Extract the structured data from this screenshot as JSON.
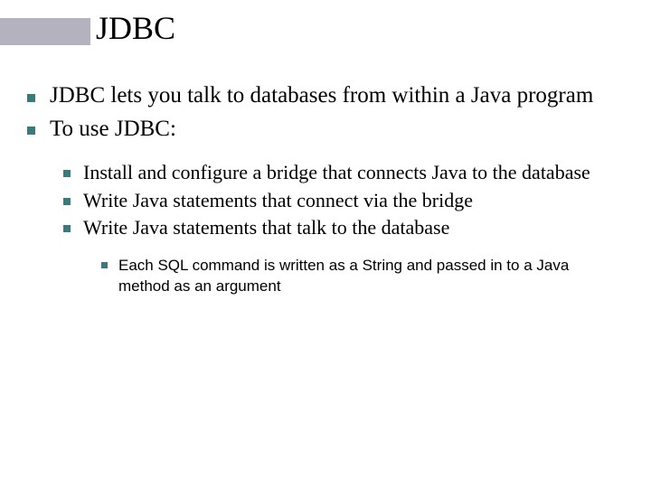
{
  "title": "JDBC",
  "level1": [
    "JDBC lets you talk to databases from within a Java program",
    "To use JDBC:"
  ],
  "level2": [
    "Install and configure a bridge that connects Java to the database",
    "Write Java statements that connect via the bridge",
    "Write Java statements that talk to the database"
  ],
  "level3": [
    "Each SQL command is written as a String and passed in to a Java method as an argument"
  ]
}
